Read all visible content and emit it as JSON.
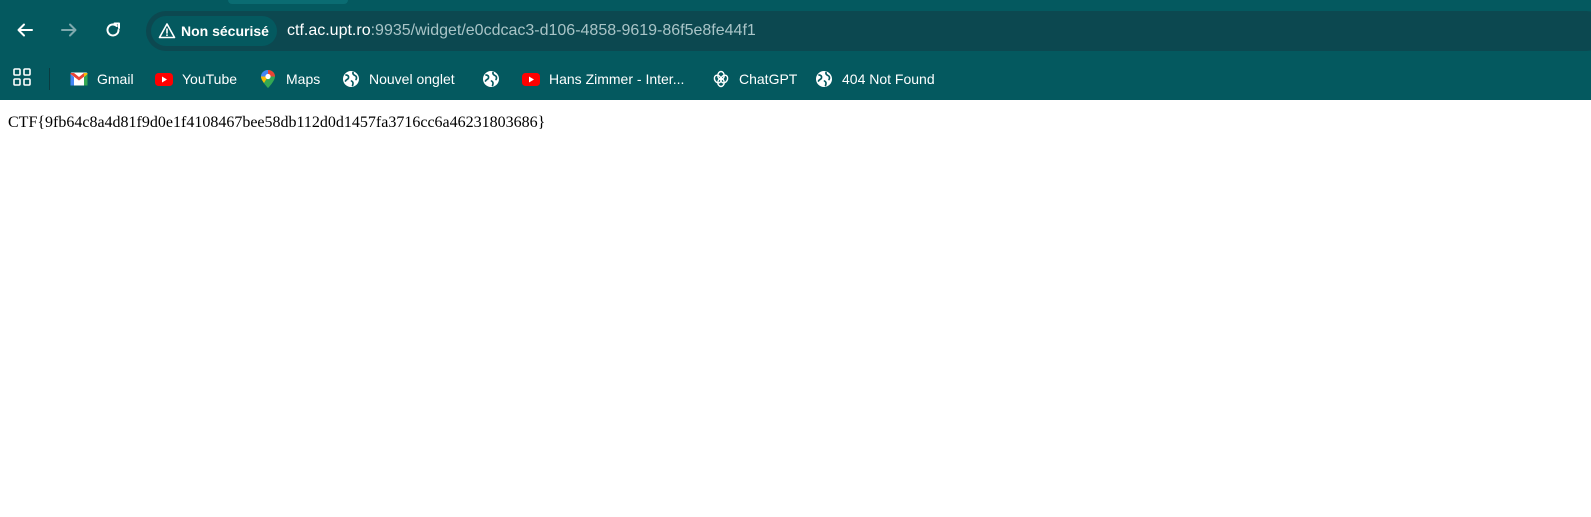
{
  "browser": {
    "colors": {
      "toolbar": "#04595f",
      "omnibox": "#0c4850",
      "url_host": "#ffffff",
      "url_path": "#a9c4c7"
    },
    "nav": {
      "back_icon": "arrow-left-icon",
      "forward_icon": "arrow-right-icon",
      "reload_icon": "reload-icon"
    },
    "omnibox": {
      "security_label": "Non sécurisé",
      "security_icon": "warning-triangle-icon",
      "url_host": "ctf.ac.upt.ro",
      "url_path": ":9935/widget/e0cdcac3-d106-4858-9619-86f5e8fe44f1"
    },
    "bookmarks": [
      {
        "label": "Gmail",
        "icon": "gmail-icon"
      },
      {
        "label": "YouTube",
        "icon": "youtube-icon"
      },
      {
        "label": "Maps",
        "icon": "maps-pin-icon"
      },
      {
        "label": "Nouvel onglet",
        "icon": "globe-icon"
      },
      {
        "label": "",
        "icon": "globe-icon"
      },
      {
        "label": "Hans Zimmer - Inter...",
        "icon": "youtube-icon"
      },
      {
        "label": "ChatGPT",
        "icon": "chatgpt-icon"
      },
      {
        "label": "404 Not Found",
        "icon": "globe-icon"
      }
    ]
  },
  "page": {
    "flag_text": "CTF{9fb64c8a4d81f9d0e1f4108467bee58db112d0d1457fa3716cc6a46231803686}"
  }
}
